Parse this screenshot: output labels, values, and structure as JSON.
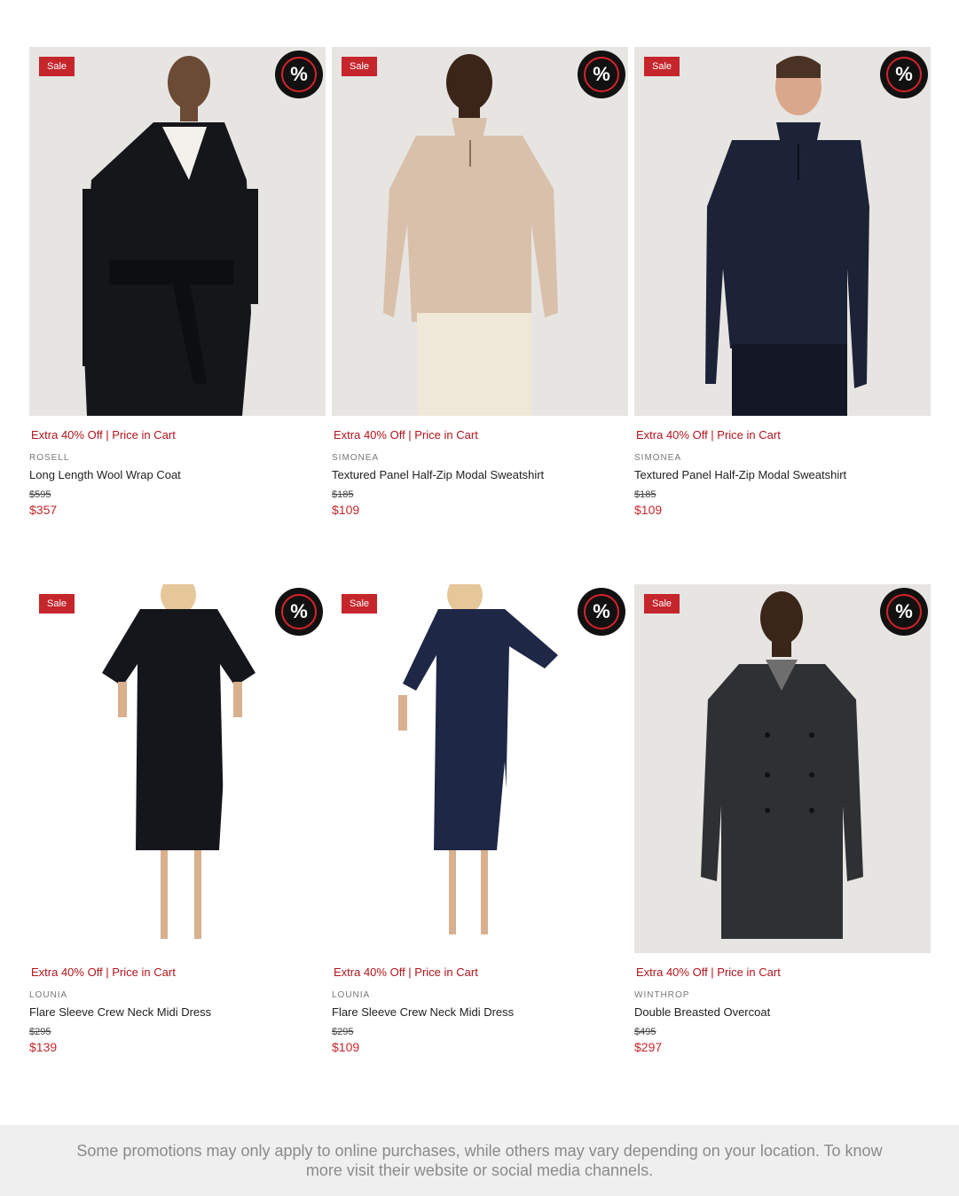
{
  "colors": {
    "sale_red": "#c5262c",
    "promo_red": "#b3141c",
    "badge_black": "#111111",
    "photo_bg": "#e7e5e2"
  },
  "products": [
    {
      "sale_label": "Sale",
      "badge_symbol": "%",
      "promo_text": "Extra 40% Off | Price in Cart",
      "brand": "ROSELL",
      "name": "Long Length Wool Wrap Coat",
      "original_price": "$595",
      "sale_price": "$357",
      "image_description": "woman-black-wrap-coat"
    },
    {
      "sale_label": "Sale",
      "badge_symbol": "%",
      "promo_text": "Extra 40% Off | Price in Cart",
      "brand": "SIMONEA",
      "name": "Textured Panel Half-Zip Modal Sweatshirt",
      "original_price": "$185",
      "sale_price": "$109",
      "image_description": "man-beige-half-zip"
    },
    {
      "sale_label": "Sale",
      "badge_symbol": "%",
      "promo_text": "Extra 40% Off | Price in Cart",
      "brand": "SIMONEA",
      "name": "Textured Panel Half-Zip Modal Sweatshirt",
      "original_price": "$185",
      "sale_price": "$109",
      "image_description": "man-navy-half-zip"
    },
    {
      "sale_label": "Sale",
      "badge_symbol": "%",
      "promo_text": "Extra 40% Off | Price in Cart",
      "brand": "LOUNIA",
      "name": "Flare Sleeve Crew Neck Midi Dress",
      "original_price": "$295",
      "sale_price": "$139",
      "image_description": "woman-black-midi-dress"
    },
    {
      "sale_label": "Sale",
      "badge_symbol": "%",
      "promo_text": "Extra 40% Off | Price in Cart",
      "brand": "LOUNIA",
      "name": "Flare Sleeve Crew Neck Midi Dress",
      "original_price": "$295",
      "sale_price": "$109",
      "image_description": "woman-navy-midi-dress"
    },
    {
      "sale_label": "Sale",
      "badge_symbol": "%",
      "promo_text": "Extra 40% Off | Price in Cart",
      "brand": "WINTHROP",
      "name": "Double Breasted Overcoat",
      "original_price": "$495",
      "sale_price": "$297",
      "image_description": "man-charcoal-overcoat"
    }
  ],
  "footer": {
    "disclaimer": "Some promotions may only apply to online purchases, while others may vary depending on your location. To know more visit their website or social media channels."
  }
}
